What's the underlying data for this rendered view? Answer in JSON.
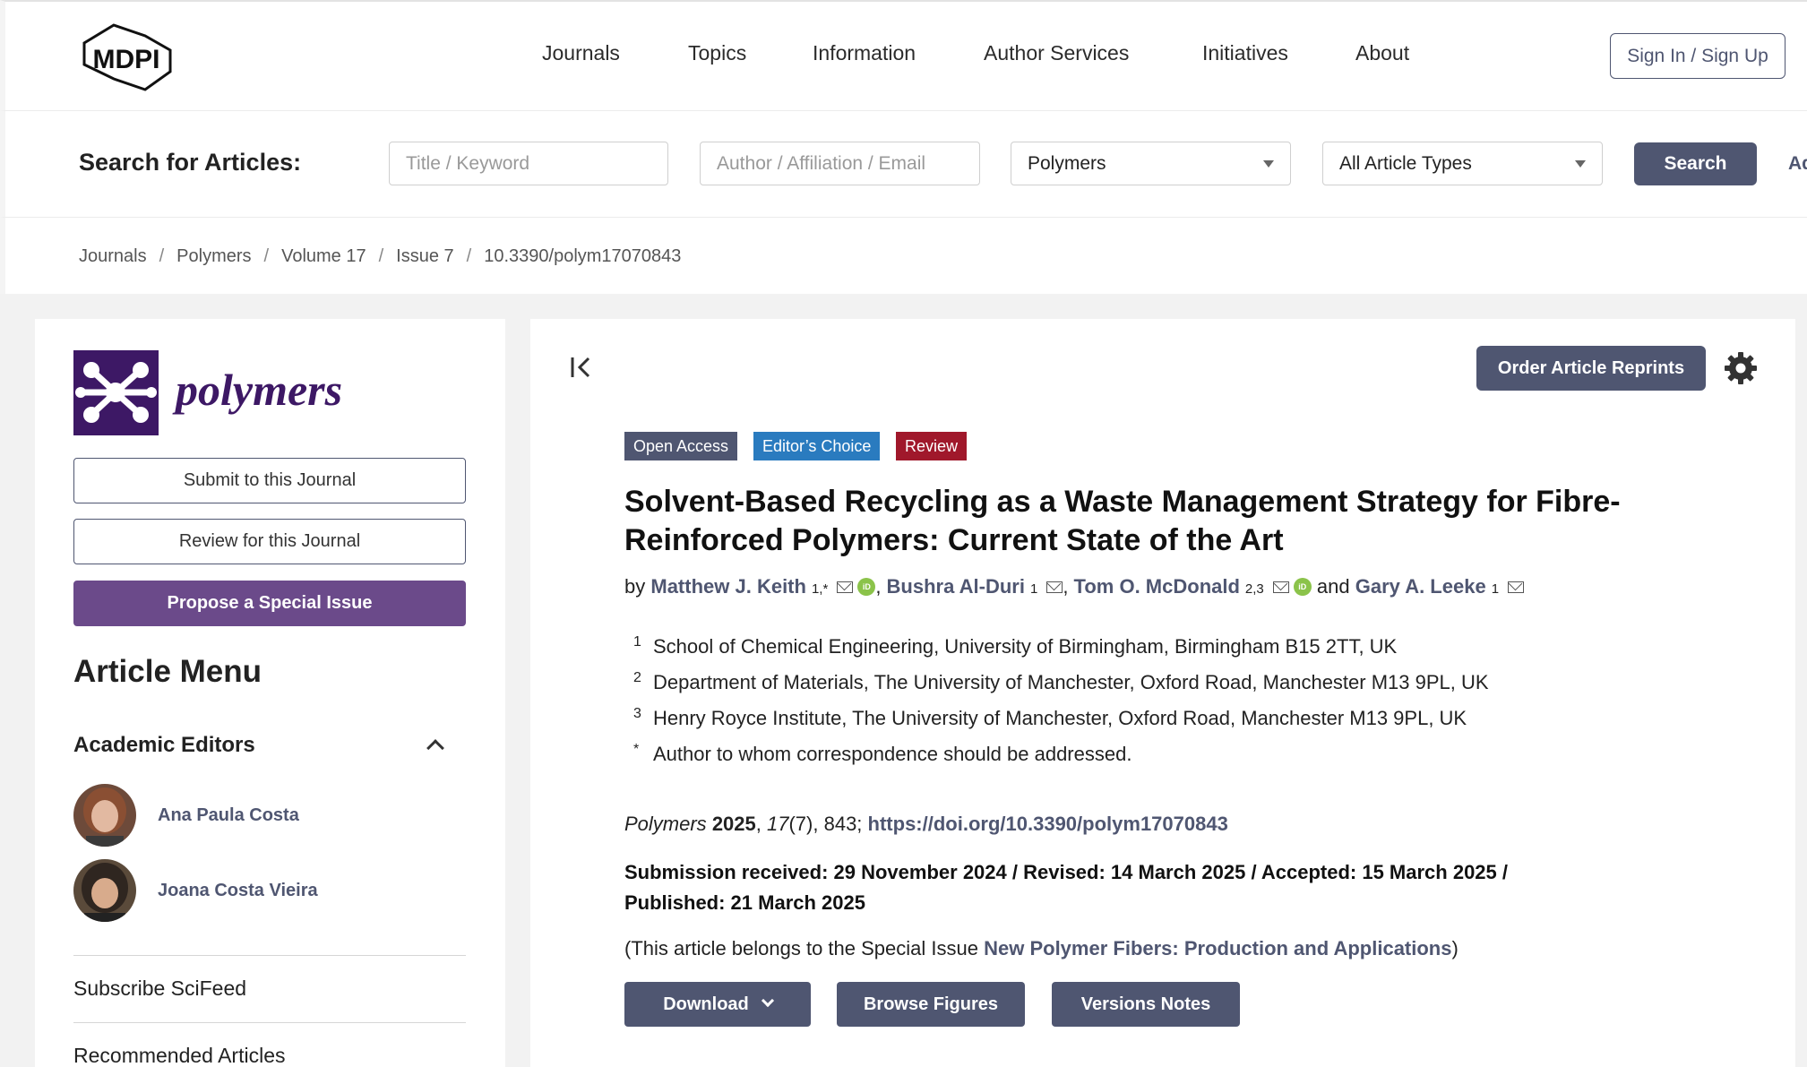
{
  "header": {
    "logo_text": "MDPI",
    "nav": [
      "Journals",
      "Topics",
      "Information",
      "Author Services",
      "Initiatives",
      "About"
    ],
    "signin_label": "Sign In / Sign Up"
  },
  "search": {
    "label": "Search for Articles:",
    "keyword_placeholder": "Title / Keyword",
    "author_placeholder": "Author / Affiliation / Email",
    "journal_value": "Polymers",
    "type_value": "All Article Types",
    "button_label": "Search",
    "advanced_label": "Ad"
  },
  "breadcrumb": [
    "Journals",
    "Polymers",
    "Volume 17",
    "Issue 7",
    "10.3390/polym17070843"
  ],
  "sidebar": {
    "journal_name": "polymers",
    "submit_label": "Submit to this Journal",
    "review_label": "Review for this Journal",
    "propose_label": "Propose a Special Issue",
    "article_menu": "Article Menu",
    "academic_editors": "Academic Editors",
    "editors": [
      "Ana Paula Costa",
      "Joana Costa Vieira"
    ],
    "subscribe": "Subscribe SciFeed",
    "recommended": "Recommended Articles"
  },
  "article": {
    "reprints_label": "Order Article Reprints",
    "badges": [
      {
        "label": "Open Access",
        "color": "#4f5671"
      },
      {
        "label": "Editor’s Choice",
        "color": "#2a7bbf"
      },
      {
        "label": "Review",
        "color": "#a0182b"
      }
    ],
    "title_line1": "Solvent-Based Recycling as a Waste Management Strategy for Fibre-",
    "title_line2": "Reinforced Polymers: Current State of the Art",
    "by": "by",
    "and": "and",
    "authors": [
      {
        "name": "Matthew J. Keith",
        "sup": "1,*"
      },
      {
        "name": "Bushra Al-Duri",
        "sup": "1"
      },
      {
        "name": "Tom O. McDonald",
        "sup": "2,3"
      },
      {
        "name": "Gary A. Leeke",
        "sup": "1"
      }
    ],
    "orcid_label": "iD",
    "affiliations": [
      {
        "num": "1",
        "text": "School of Chemical Engineering, University of Birmingham, Birmingham B15 2TT, UK"
      },
      {
        "num": "2",
        "text": "Department of Materials, The University of Manchester, Oxford Road, Manchester M13 9PL, UK"
      },
      {
        "num": "3",
        "text": "Henry Royce Institute, The University of Manchester, Oxford Road, Manchester M13 9PL, UK"
      },
      {
        "num": "*",
        "text": "Author to whom correspondence should be addressed."
      }
    ],
    "citation": {
      "journal": "Polymers",
      "year": "2025",
      "volume": "17",
      "issue_pages": "(7), 843;",
      "doi": "https://doi.org/10.3390/polym17070843"
    },
    "dates_line1": "Submission received: 29 November 2024 / Revised: 14 March 2025 / Accepted: 15 March 2025 /",
    "dates_line2": "Published: 21 March 2025",
    "special_prefix": "(This article belongs to the Special Issue",
    "special_link": "New Polymer Fibers: Production and Applications",
    "special_suffix": ")",
    "download_label": "Download",
    "figures_label": "Browse Figures",
    "versions_label": "Versions Notes"
  }
}
